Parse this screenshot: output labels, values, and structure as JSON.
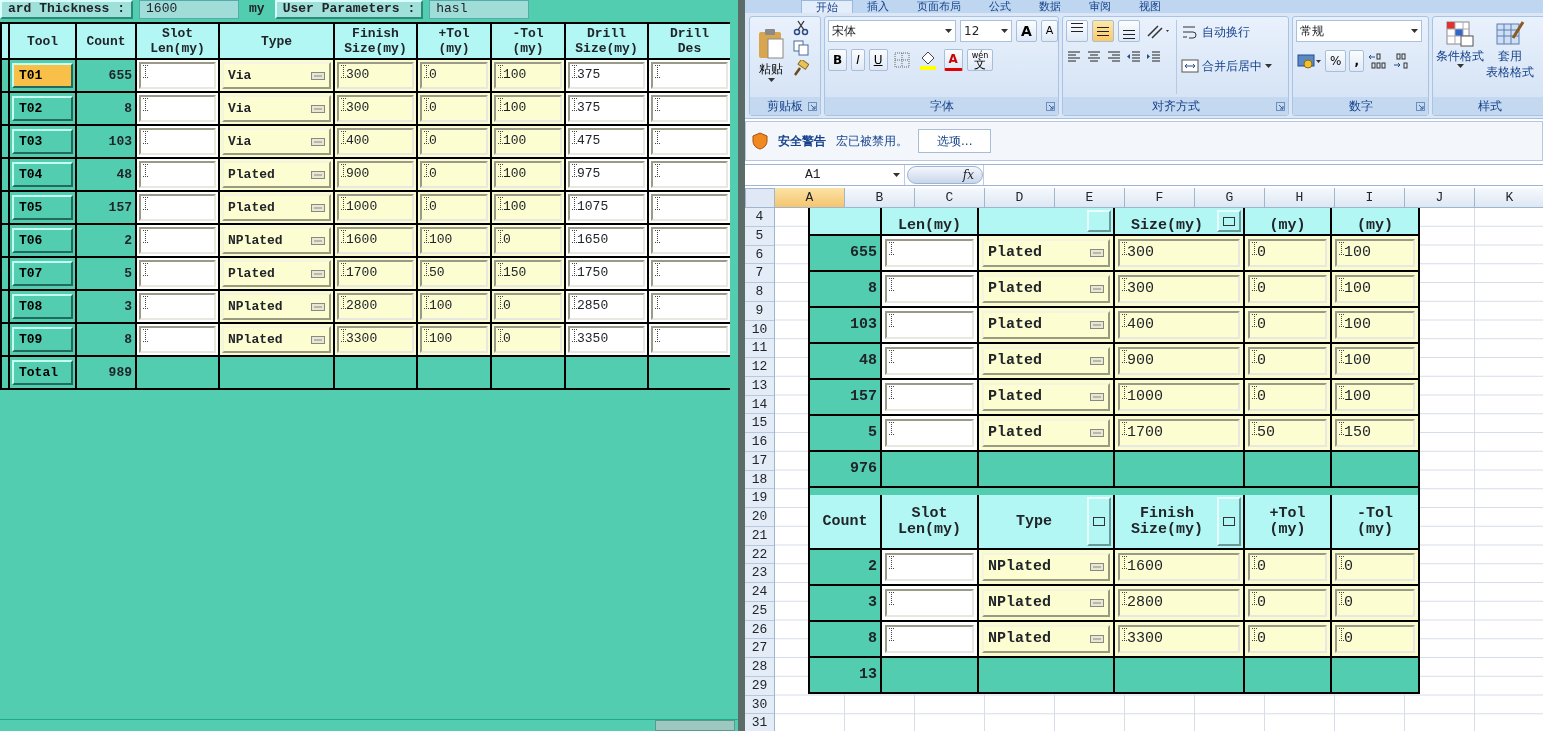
{
  "tool_window": {
    "header_fields": [
      {
        "label": "ard Thickness :",
        "value": "1600",
        "unit": "my"
      },
      {
        "label": "User Parameters :",
        "value": "hasl"
      }
    ],
    "columns": [
      "Tool",
      "Count",
      "Slot\nLen(my)",
      "Type",
      "Finish\nSize(my)",
      "+Tol\n(my)",
      "-Tol\n(my)",
      "Drill\nSize(my)",
      "Drill\nDes"
    ],
    "rows": [
      {
        "tool": "T01",
        "selected": true,
        "count": "655",
        "type": "Via",
        "finish_size": "300",
        "plus_tol": "0",
        "minus_tol": "100",
        "drill_size": "375"
      },
      {
        "tool": "T02",
        "selected": false,
        "count": "8",
        "type": "Via",
        "finish_size": "300",
        "plus_tol": "0",
        "minus_tol": "100",
        "drill_size": "375"
      },
      {
        "tool": "T03",
        "selected": false,
        "count": "103",
        "type": "Via",
        "finish_size": "400",
        "plus_tol": "0",
        "minus_tol": "100",
        "drill_size": "475"
      },
      {
        "tool": "T04",
        "selected": false,
        "count": "48",
        "type": "Plated",
        "finish_size": "900",
        "plus_tol": "0",
        "minus_tol": "100",
        "drill_size": "975"
      },
      {
        "tool": "T05",
        "selected": false,
        "count": "157",
        "type": "Plated",
        "finish_size": "1000",
        "plus_tol": "0",
        "minus_tol": "100",
        "drill_size": "1075"
      },
      {
        "tool": "T06",
        "selected": false,
        "count": "2",
        "type": "NPlated",
        "finish_size": "1600",
        "plus_tol": "100",
        "minus_tol": "0",
        "drill_size": "1650"
      },
      {
        "tool": "T07",
        "selected": false,
        "count": "5",
        "type": "Plated",
        "finish_size": "1700",
        "plus_tol": "50",
        "minus_tol": "150",
        "drill_size": "1750"
      },
      {
        "tool": "T08",
        "selected": false,
        "count": "3",
        "type": "NPlated",
        "finish_size": "2800",
        "plus_tol": "100",
        "minus_tol": "0",
        "drill_size": "2850"
      },
      {
        "tool": "T09",
        "selected": false,
        "count": "8",
        "type": "NPlated",
        "finish_size": "3300",
        "plus_tol": "100",
        "minus_tol": "0",
        "drill_size": "3350"
      }
    ],
    "total": {
      "label": "Total",
      "count": "989"
    }
  },
  "spreadsheet": {
    "tabs": [
      {
        "label": "开始",
        "selected": true
      },
      {
        "label": "插入",
        "selected": false
      },
      {
        "label": "页面布局",
        "selected": false
      },
      {
        "label": "公式",
        "selected": false
      },
      {
        "label": "数据",
        "selected": false
      },
      {
        "label": "审阅",
        "selected": false
      },
      {
        "label": "视图",
        "selected": false
      }
    ],
    "ribbon": [
      {
        "kind": "clipboard",
        "label": "剪贴板",
        "paste": "粘贴"
      },
      {
        "kind": "font",
        "label": "字体",
        "font_name": "宋体",
        "font_size": "12",
        "grow": "A",
        "shrink": "A",
        "bold": "B",
        "italic": "I",
        "underline": "U",
        "font_color": "A",
        "phonetic_top": "wén",
        "phonetic": "文"
      },
      {
        "kind": "alignment",
        "label": "对齐方式",
        "vertical_align": [
          {
            "selected": false
          },
          {
            "selected": true
          },
          {
            "selected": false
          }
        ],
        "wrap": "自动换行",
        "merge": "合并后居中"
      },
      {
        "kind": "number",
        "label": "数字",
        "format": "常规",
        "percent": "%",
        "comma": ","
      },
      {
        "kind": "styles",
        "label": "样式",
        "conditional": "条件格式",
        "table_format": [
          "套用",
          "表格格式"
        ]
      }
    ],
    "security_bar": {
      "title": "安全警告",
      "message": "宏已被禁用。",
      "button": "选项..."
    },
    "name_box": "A1",
    "function_label": "fx",
    "column_headers": [
      {
        "label": "A",
        "selected": true
      },
      {
        "label": "B",
        "selected": false
      },
      {
        "label": "C",
        "selected": false
      },
      {
        "label": "D",
        "selected": false
      },
      {
        "label": "E",
        "selected": false
      },
      {
        "label": "F",
        "selected": false
      },
      {
        "label": "G",
        "selected": false
      },
      {
        "label": "H",
        "selected": false
      },
      {
        "label": "I",
        "selected": false
      },
      {
        "label": "J",
        "selected": false
      },
      {
        "label": "K",
        "selected": false
      }
    ],
    "row_numbers": [
      "4",
      "5",
      "6",
      "7",
      "8",
      "9",
      "10",
      "11",
      "12",
      "13",
      "14",
      "15",
      "16",
      "17",
      "18",
      "19",
      "20",
      "21",
      "22",
      "23",
      "24",
      "25",
      "26",
      "27",
      "28",
      "29",
      "30",
      "31"
    ],
    "embedded_tables": [
      {
        "header": [
          {
            "kind": "blank"
          },
          {
            "kind": "text",
            "text": "Len(my)"
          },
          {
            "kind": "button_only"
          },
          {
            "kind": "button",
            "text": "Size(my)"
          },
          {
            "kind": "text",
            "text": "(my)"
          },
          {
            "kind": "text",
            "text": "(my)"
          }
        ],
        "rows": [
          {
            "count": "655",
            "type": "Plated",
            "finish_size": "300",
            "plus_tol": "0",
            "minus_tol": "100"
          },
          {
            "count": "8",
            "type": "Plated",
            "finish_size": "300",
            "plus_tol": "0",
            "minus_tol": "100"
          },
          {
            "count": "103",
            "type": "Plated",
            "finish_size": "400",
            "plus_tol": "0",
            "minus_tol": "100"
          },
          {
            "count": "48",
            "type": "Plated",
            "finish_size": "900",
            "plus_tol": "0",
            "minus_tol": "100"
          },
          {
            "count": "157",
            "type": "Plated",
            "finish_size": "1000",
            "plus_tol": "0",
            "minus_tol": "100"
          },
          {
            "count": "5",
            "type": "Plated",
            "finish_size": "1700",
            "plus_tol": "50",
            "minus_tol": "150"
          }
        ],
        "total": "976"
      },
      {
        "header": [
          {
            "kind": "text",
            "text": "Count"
          },
          {
            "kind": "text",
            "text": "Slot\nLen(my)"
          },
          {
            "kind": "button",
            "text": "Type"
          },
          {
            "kind": "button",
            "text": "Finish\nSize(my)"
          },
          {
            "kind": "text",
            "text": "+Tol\n(my)"
          },
          {
            "kind": "text",
            "text": "-Tol\n(my)"
          }
        ],
        "rows": [
          {
            "count": "2",
            "type": "NPlated",
            "finish_size": "1600",
            "plus_tol": "0",
            "minus_tol": "0"
          },
          {
            "count": "3",
            "type": "NPlated",
            "finish_size": "2800",
            "plus_tol": "0",
            "minus_tol": "0"
          },
          {
            "count": "8",
            "type": "NPlated",
            "finish_size": "3300",
            "plus_tol": "0",
            "minus_tol": "0"
          }
        ],
        "total": "13"
      }
    ]
  }
}
